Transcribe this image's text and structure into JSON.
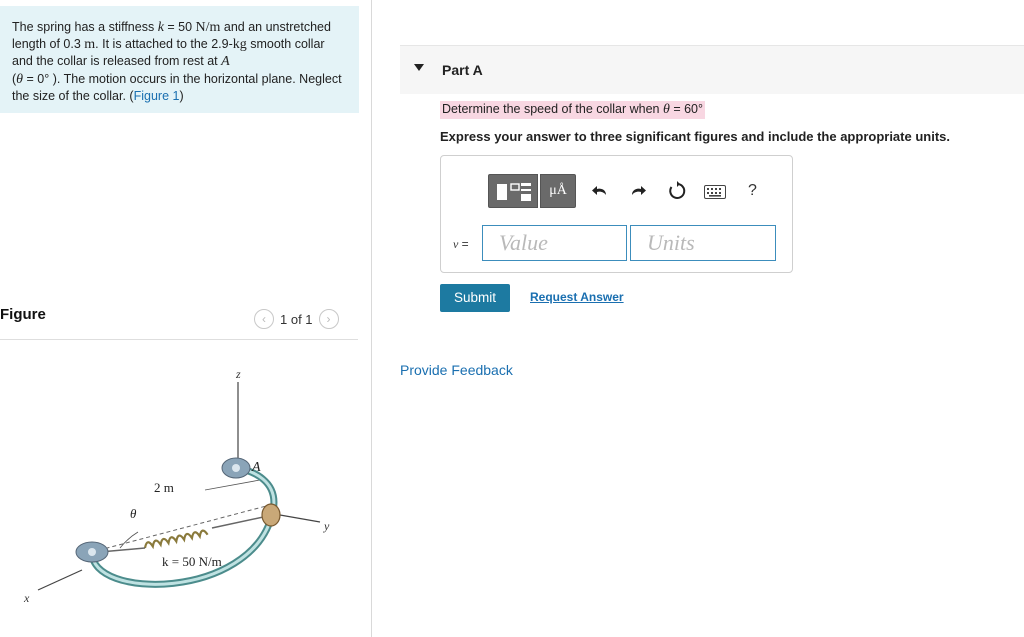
{
  "problem": {
    "text_1": "The spring has a stiffness ",
    "k_symbol": "k",
    "text_2": " = 50 ",
    "k_units": "N/m",
    "text_3": " and an unstretched length of 0.3 ",
    "len_unit": "m",
    "text_4": ". It is attached to the 2.9-",
    "mass_unit": "kg",
    "text_5": " smooth collar and the collar is released from rest at ",
    "point": "A",
    "text_6": " (",
    "theta": "θ",
    "text_7": " = 0° ). The motion occurs in the horizontal plane. Neglect the size of the collar. (",
    "figure_link": "Figure 1",
    "text_8": ")"
  },
  "figure": {
    "title": "Figure",
    "pager_text": "1 of 1",
    "prev_icon": "chevron-left-icon",
    "next_icon": "chevron-right-icon",
    "labels": {
      "z": "z",
      "y": "y",
      "x": "x",
      "A": "A",
      "theta": "θ",
      "radius": "2 m",
      "spring": "k = 50 N/m"
    }
  },
  "part": {
    "title": "Part A",
    "question_prefix": "Determine the speed of the collar when ",
    "question_theta": "θ",
    "question_suffix": " = 60°",
    "instructions": "Express your answer to three significant figures and include the appropriate units."
  },
  "answer": {
    "variable": "v",
    "equals": " =",
    "value_placeholder": "Value",
    "units_placeholder": "Units",
    "units_tool_label": "μÅ",
    "help_label": "?"
  },
  "toolbar_icons": [
    "templates-icon",
    "units-icon",
    "undo-icon",
    "redo-icon",
    "reset-icon",
    "keyboard-icon",
    "help-icon"
  ],
  "actions": {
    "submit": "Submit",
    "request_answer": "Request Answer",
    "provide_feedback": "Provide Feedback"
  },
  "colors": {
    "problem_bg": "#e4f3f7",
    "question_highlight": "#f8d7e2",
    "submit_bg": "#1d7aa1",
    "link": "#1a6fb0",
    "input_border": "#3c8dbc"
  }
}
